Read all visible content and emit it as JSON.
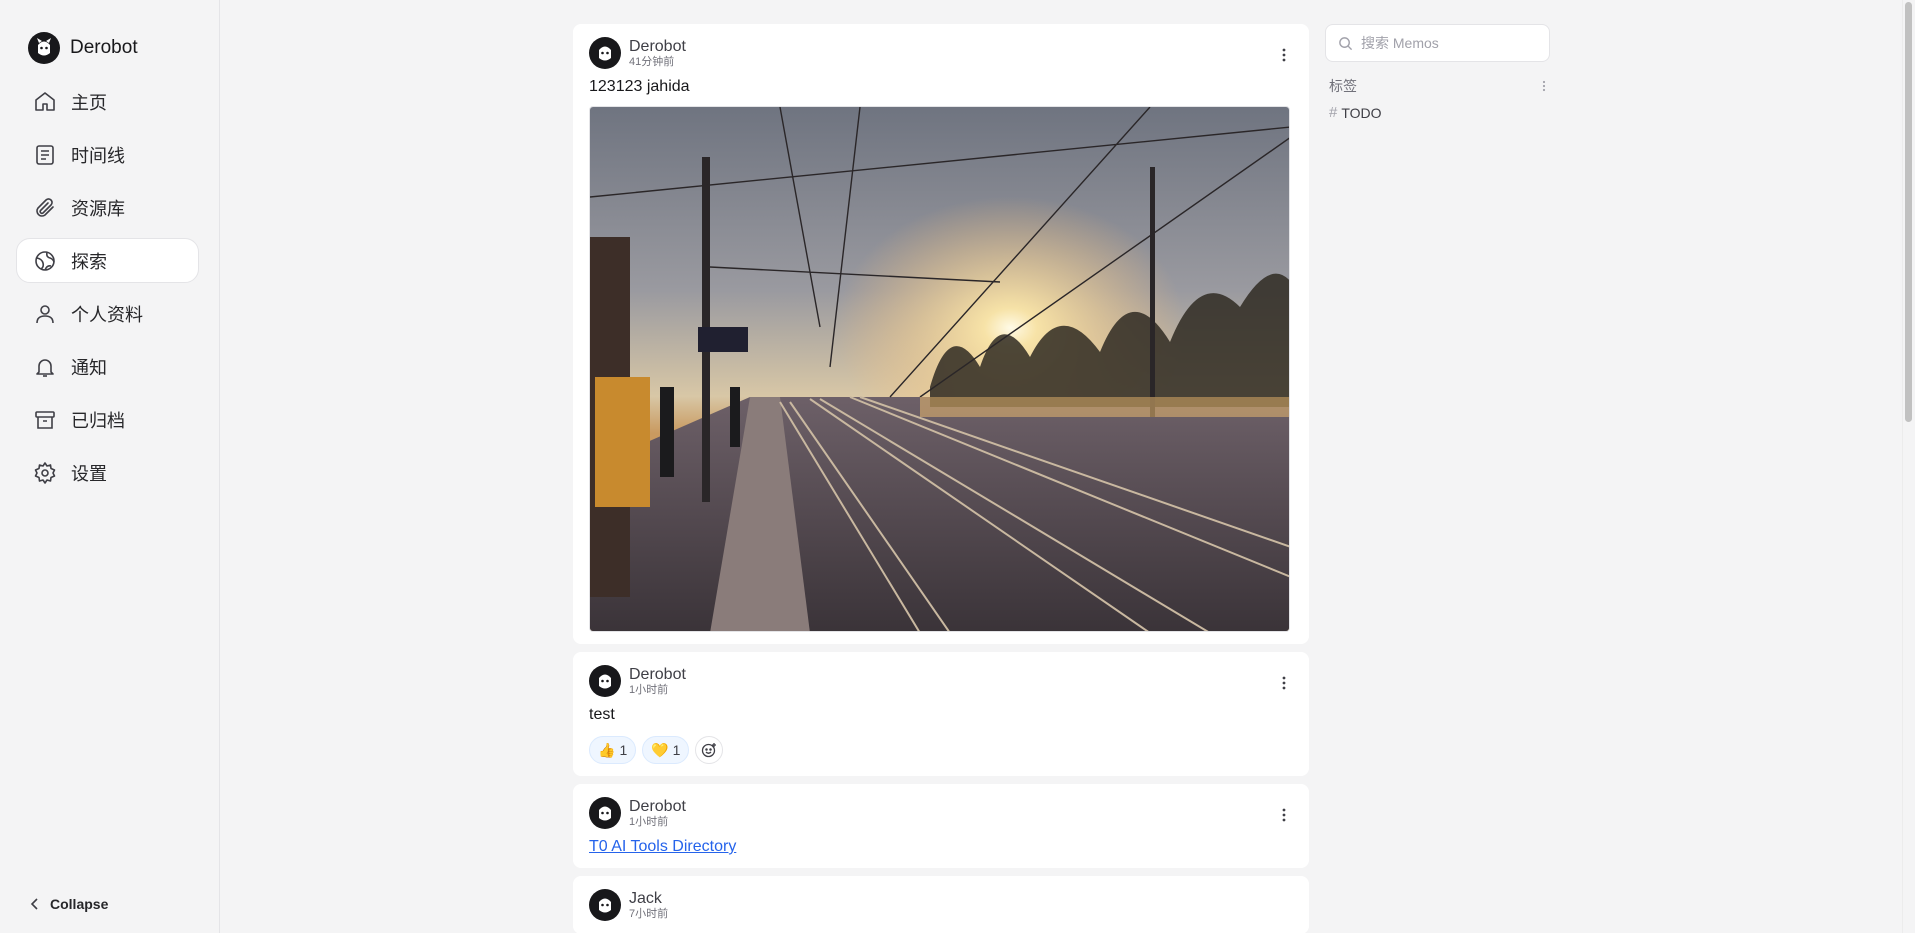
{
  "brand": {
    "name": "Derobot"
  },
  "nav": [
    {
      "label": "主页",
      "icon": "home-icon"
    },
    {
      "label": "时间线",
      "icon": "timeline-icon"
    },
    {
      "label": "资源库",
      "icon": "paperclip-icon"
    },
    {
      "label": "探索",
      "icon": "explore-icon",
      "active": true
    },
    {
      "label": "个人资料",
      "icon": "user-icon"
    },
    {
      "label": "通知",
      "icon": "bell-icon"
    },
    {
      "label": "已归档",
      "icon": "archive-icon"
    },
    {
      "label": "设置",
      "icon": "gear-icon"
    }
  ],
  "collapse_label": "Collapse",
  "memos": [
    {
      "author": "Derobot",
      "time": "41分钟前",
      "content": "123123 jahida",
      "has_image": true
    },
    {
      "author": "Derobot",
      "time": "1小时前",
      "content": "test",
      "reactions": [
        {
          "emoji": "👍",
          "count": "1"
        },
        {
          "emoji": "💛",
          "count": "1"
        }
      ]
    },
    {
      "author": "Derobot",
      "time": "1小时前",
      "link": "T0 AI Tools Directory"
    },
    {
      "author": "Jack",
      "time": "7小时前"
    }
  ],
  "search": {
    "placeholder": "搜索 Memos"
  },
  "tags": {
    "title": "标签",
    "items": [
      "TODO"
    ]
  }
}
